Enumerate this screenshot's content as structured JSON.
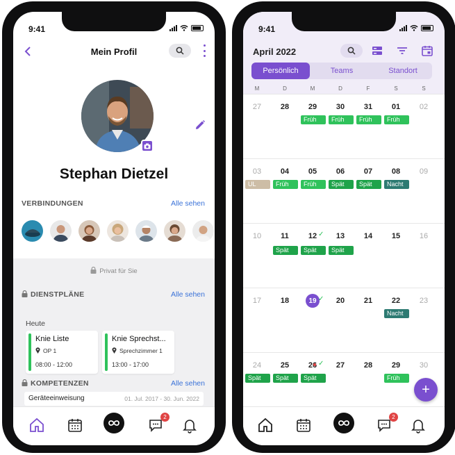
{
  "status": {
    "time": "9:41"
  },
  "profile": {
    "title": "Mein Profil",
    "name": "Stephan Dietzel",
    "connections_label": "VERBINDUNGEN",
    "see_all": "Alle sehen",
    "private_label": "Privat für Sie",
    "duty_label": "DIENSTPLÄNE",
    "today_label": "Heute",
    "cards": [
      {
        "title": "Knie Liste",
        "location": "OP 1",
        "time": "08:00 - 12:00"
      },
      {
        "title": "Knie Sprechst...",
        "location": "Sprechzimmer 1",
        "time": "13:00 - 17:00"
      }
    ],
    "skills_label": "KOMPETENZEN",
    "skill": {
      "name": "Geräteeinweisung",
      "range": "01. Jul. 2017 - 30. Jun. 2022"
    }
  },
  "calendar": {
    "month": "April 2022",
    "tabs": [
      "Persönlich",
      "Teams",
      "Standort"
    ],
    "weekdays": [
      "M",
      "D",
      "M",
      "D",
      "F",
      "S",
      "S"
    ],
    "weeks": [
      {
        "days": [
          "27",
          "28",
          "29",
          "30",
          "31",
          "01",
          "02"
        ],
        "shifts": [
          {
            "col": 2,
            "label": "Früh",
            "c": "green"
          },
          {
            "col": 3,
            "label": "Früh",
            "c": "green"
          },
          {
            "col": 4,
            "label": "Früh",
            "c": "green"
          },
          {
            "col": 5,
            "label": "Früh",
            "c": "green"
          }
        ]
      },
      {
        "days": [
          "03",
          "04",
          "05",
          "06",
          "07",
          "08",
          "09"
        ],
        "shifts": [
          {
            "col": 0,
            "label": "UL",
            "c": "tan"
          },
          {
            "col": 1,
            "label": "Früh",
            "c": "green"
          },
          {
            "col": 2,
            "label": "Früh",
            "c": "green"
          },
          {
            "col": 3,
            "label": "Spät",
            "c": "dgreen"
          },
          {
            "col": 4,
            "label": "Spät",
            "c": "dgreen"
          },
          {
            "col": 5,
            "label": "Nacht",
            "c": "teal"
          }
        ]
      },
      {
        "days": [
          "10",
          "11",
          "12",
          "13",
          "14",
          "15",
          "16"
        ],
        "shifts": [
          {
            "col": 1,
            "label": "Spät",
            "c": "dgreen"
          },
          {
            "col": 2,
            "label": "Spät",
            "c": "dgreen"
          },
          {
            "col": 3,
            "label": "Spät",
            "c": "dgreen"
          }
        ]
      },
      {
        "days": [
          "17",
          "18",
          "19",
          "20",
          "21",
          "22",
          "23"
        ],
        "shifts": [
          {
            "col": 5,
            "label": "Nacht",
            "c": "teal"
          }
        ]
      },
      {
        "days": [
          "24",
          "25",
          "26",
          "27",
          "28",
          "29",
          "30"
        ],
        "shifts": [
          {
            "col": 0,
            "label": "Spät",
            "c": "dgreen"
          },
          {
            "col": 1,
            "label": "Spät",
            "c": "dgreen"
          },
          {
            "col": 2,
            "label": "Spät",
            "c": "dgreen"
          },
          {
            "col": 5,
            "label": "Früh",
            "c": "green"
          }
        ]
      }
    ],
    "fab_label": "+"
  },
  "tabbar": {
    "badge": "2"
  },
  "colors": {
    "accent": "#7a4fcf",
    "shift_early": "#2fc25b",
    "shift_late": "#1fa34a",
    "shift_night": "#2d7a72",
    "leave": "#cdbda6"
  }
}
